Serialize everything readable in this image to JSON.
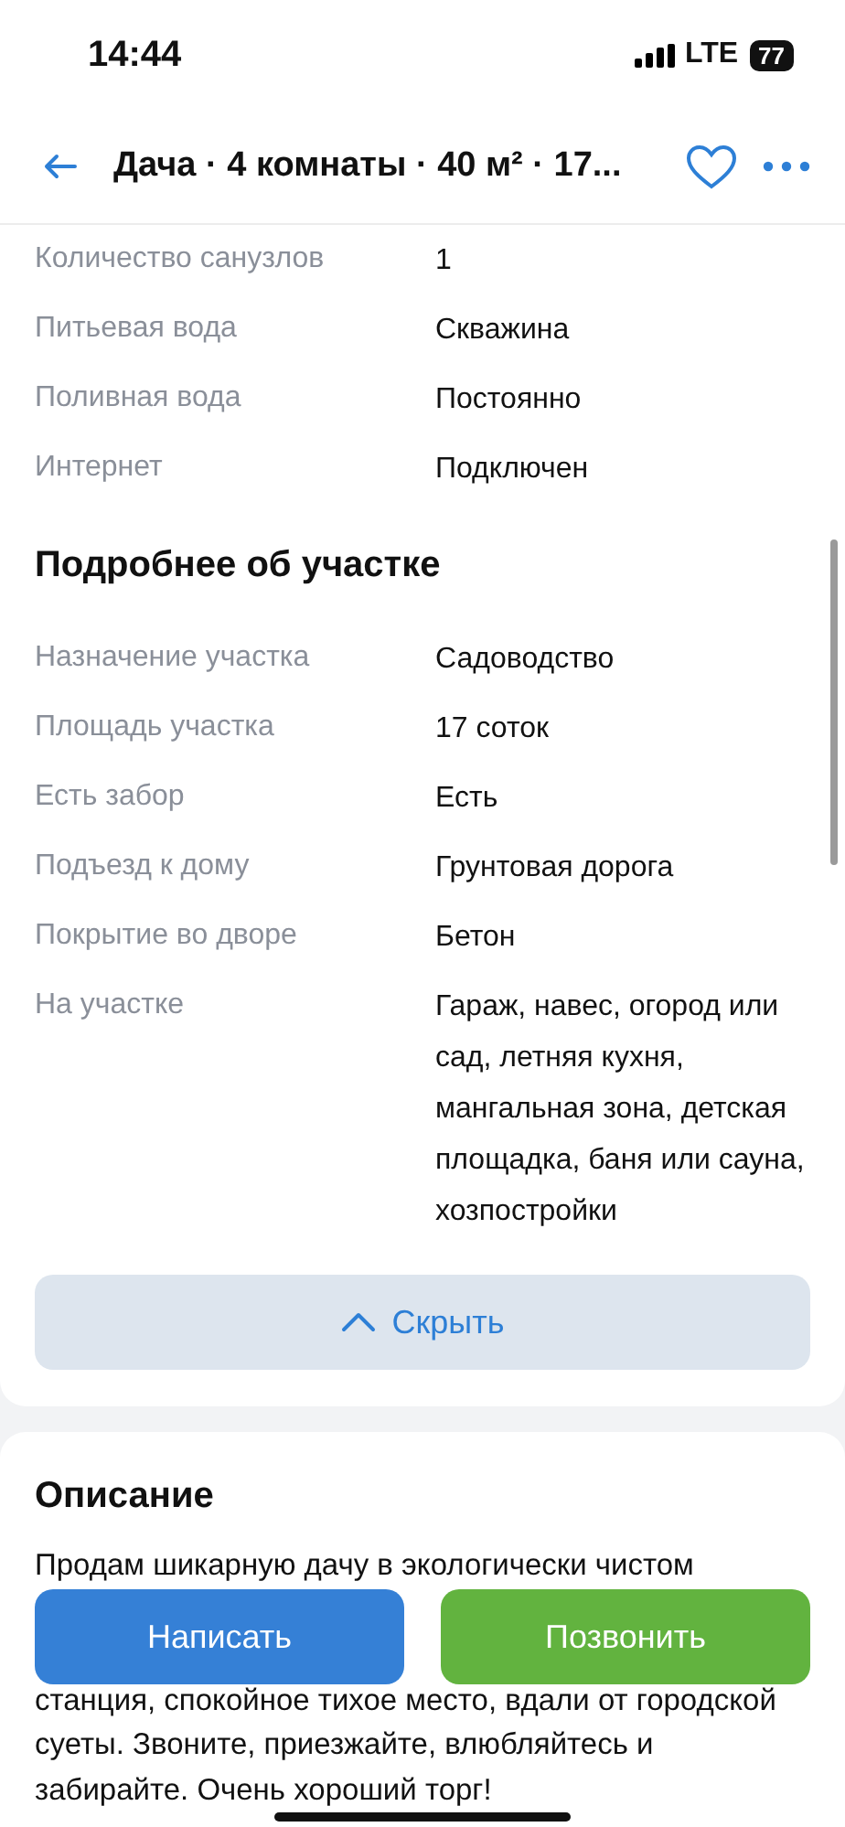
{
  "status_bar": {
    "time": "14:44",
    "network": "LTE",
    "battery": "77"
  },
  "header": {
    "title": "Дача · 4 комнаты · 40 м² · 17...",
    "favorite": false
  },
  "rows": [
    {
      "label": "Количество санузлов",
      "value": "1"
    },
    {
      "label": "Питьевая вода",
      "value": "Скважина"
    },
    {
      "label": "Поливная вода",
      "value": "Постоянно"
    },
    {
      "label": "Интернет",
      "value": "Подключен"
    }
  ],
  "plot_section": {
    "title": "Подробнее об участке",
    "rows": [
      {
        "label": "Назначение участка",
        "value": "Садоводство"
      },
      {
        "label": "Площадь участка",
        "value": "17 соток"
      },
      {
        "label": "Есть забор",
        "value": "Есть"
      },
      {
        "label": "Подъезд к дому",
        "value": "Грунтовая дорога"
      },
      {
        "label": "Покрытие во дворе",
        "value": "Бетон"
      },
      {
        "label": "На участке",
        "value": "Гараж, навес, огород или сад, летняя кухня, мангальная зона, детская площадка, баня или сауна, хозпостройки"
      }
    ]
  },
  "hide_button": "Скрыть",
  "description": {
    "title": "Описание",
    "lines": [
      {
        "text": "Продам шикарную дачу в экологически чистом",
        "kind": "full"
      },
      {
        "kind": "covered"
      },
      {
        "kind": "covered"
      },
      {
        "text": "станция, спокойное тихое место, вдали от городской",
        "kind": "full"
      },
      {
        "text": "суеты. Звоните, приезжайте, влюбляйтесь и",
        "kind": "full"
      },
      {
        "text": "забирайте. Очень хороший торг!",
        "kind": "full"
      }
    ]
  },
  "actions": [
    {
      "label": "Написать",
      "kind": "message"
    },
    {
      "label": "Позвонить",
      "kind": "call"
    }
  ]
}
